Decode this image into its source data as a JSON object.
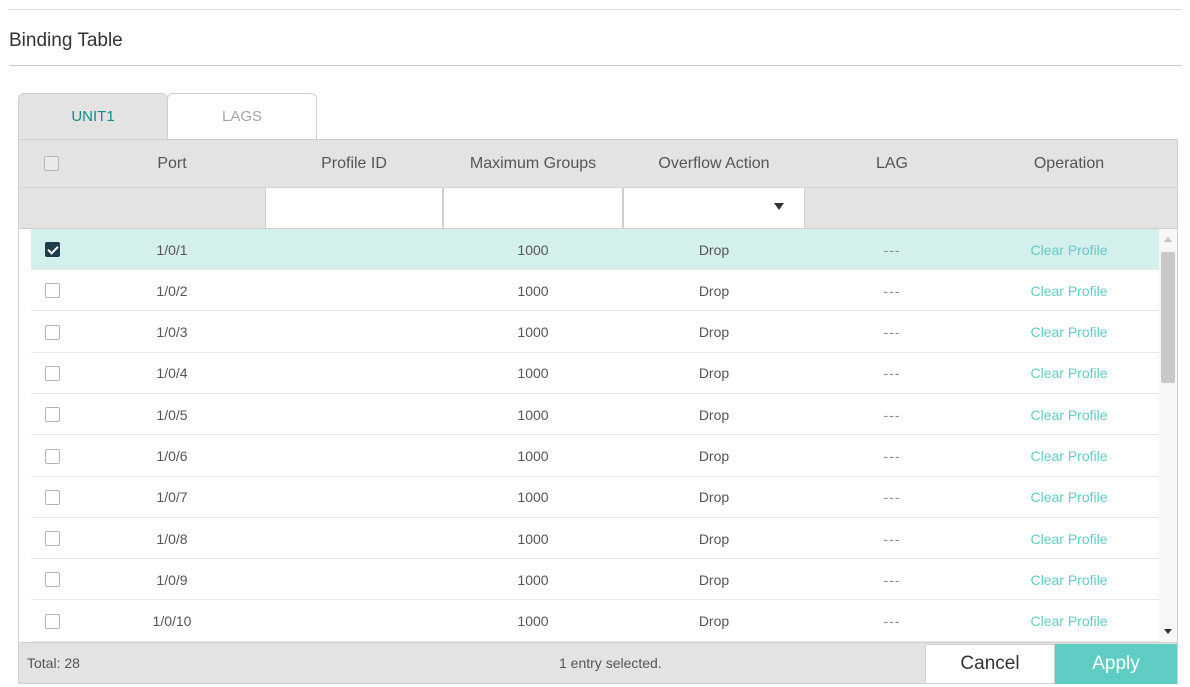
{
  "panel": {
    "title": "Binding Table"
  },
  "tabs": [
    {
      "label": "UNIT1",
      "active": true
    },
    {
      "label": "LAGS",
      "active": false
    }
  ],
  "columns": [
    "Port",
    "Profile ID",
    "Maximum Groups",
    "Overflow Action",
    "LAG",
    "Operation"
  ],
  "filters": {
    "profile_id": "",
    "maximum_groups": "",
    "overflow_action": ""
  },
  "rows": [
    {
      "checked": true,
      "port": "1/0/1",
      "profile_id": "",
      "max_groups": "1000",
      "overflow": "Drop",
      "lag": "---",
      "operation": "Clear Profile"
    },
    {
      "checked": false,
      "port": "1/0/2",
      "profile_id": "",
      "max_groups": "1000",
      "overflow": "Drop",
      "lag": "---",
      "operation": "Clear Profile"
    },
    {
      "checked": false,
      "port": "1/0/3",
      "profile_id": "",
      "max_groups": "1000",
      "overflow": "Drop",
      "lag": "---",
      "operation": "Clear Profile"
    },
    {
      "checked": false,
      "port": "1/0/4",
      "profile_id": "",
      "max_groups": "1000",
      "overflow": "Drop",
      "lag": "---",
      "operation": "Clear Profile"
    },
    {
      "checked": false,
      "port": "1/0/5",
      "profile_id": "",
      "max_groups": "1000",
      "overflow": "Drop",
      "lag": "---",
      "operation": "Clear Profile"
    },
    {
      "checked": false,
      "port": "1/0/6",
      "profile_id": "",
      "max_groups": "1000",
      "overflow": "Drop",
      "lag": "---",
      "operation": "Clear Profile"
    },
    {
      "checked": false,
      "port": "1/0/7",
      "profile_id": "",
      "max_groups": "1000",
      "overflow": "Drop",
      "lag": "---",
      "operation": "Clear Profile"
    },
    {
      "checked": false,
      "port": "1/0/8",
      "profile_id": "",
      "max_groups": "1000",
      "overflow": "Drop",
      "lag": "---",
      "operation": "Clear Profile"
    },
    {
      "checked": false,
      "port": "1/0/9",
      "profile_id": "",
      "max_groups": "1000",
      "overflow": "Drop",
      "lag": "---",
      "operation": "Clear Profile"
    },
    {
      "checked": false,
      "port": "1/0/10",
      "profile_id": "",
      "max_groups": "1000",
      "overflow": "Drop",
      "lag": "---",
      "operation": "Clear Profile"
    }
  ],
  "footer": {
    "total": "Total: 28",
    "selection": "1 entry selected.",
    "cancel_label": "Cancel",
    "apply_label": "Apply"
  },
  "colors": {
    "accent": "#5fcdc4",
    "tab_active_text": "#0c8f8a",
    "selected_row": "#d4f0ec",
    "header_bg": "#e3e3e3"
  }
}
